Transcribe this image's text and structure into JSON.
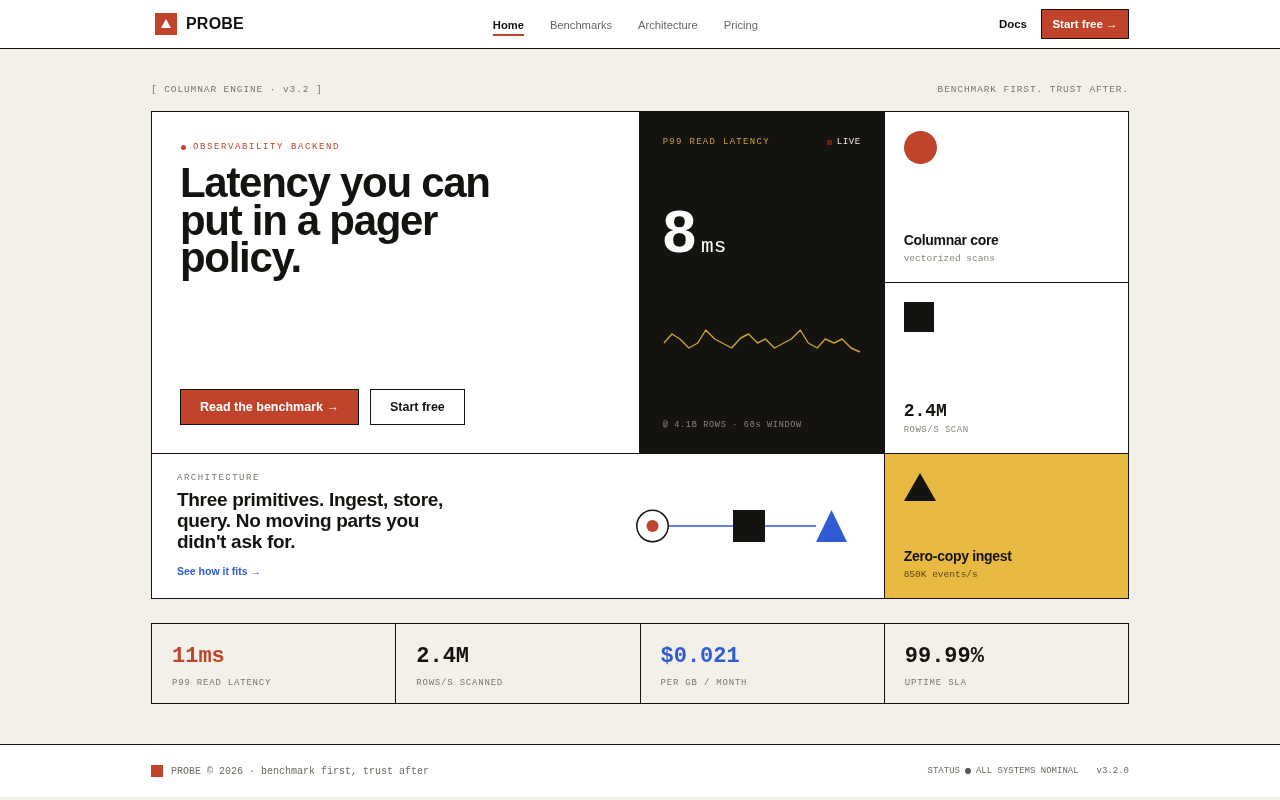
{
  "header": {
    "logo": "PROBE",
    "nav": [
      {
        "label": "Home",
        "selected": true
      },
      {
        "label": "Benchmarks",
        "selected": false
      },
      {
        "label": "Architecture",
        "selected": false
      },
      {
        "label": "Pricing",
        "selected": false
      }
    ],
    "docs_link": "Docs",
    "cta": "Start free →"
  },
  "intro": {
    "tag": "[ COLUMNAR ENGINE · v3.2 ]",
    "motto": "BENCHMARK FIRST. TRUST AFTER."
  },
  "hero": {
    "eyebrow": "OBSERVABILITY BACKEND",
    "title": "Latency you can put in a pager policy.",
    "buttons": [
      {
        "label": "Read the benchmark →",
        "kind": "primary"
      },
      {
        "label": "Start free",
        "kind": "secondary"
      }
    ]
  },
  "latency_card": {
    "label": "P99 READ LATENCY",
    "live": "LIVE",
    "value": "8",
    "unit": "ms",
    "footnote": "@ 4.1B ROWS · 60s WINDOW"
  },
  "core_card": {
    "title": "Columnar core",
    "caption": "vectorized scans"
  },
  "scan_card": {
    "value": "2.4M",
    "caption": "ROWS/S SCAN"
  },
  "architecture": {
    "label": "ARCHITECTURE",
    "title": "Three primitives. Ingest, store, query. No moving parts you didn't ask for.",
    "link": "See how it fits →"
  },
  "ingest_card": {
    "title": "Zero-copy ingest",
    "caption": "850K events/s"
  },
  "stats": [
    {
      "value": "11ms",
      "label": "P99 READ LATENCY",
      "color": "#c0432b"
    },
    {
      "value": "2.4M",
      "label": "ROWS/S SCANNED",
      "color": "#15130f"
    },
    {
      "value": "$0.021",
      "label": "PER GB / MONTH",
      "color": "#2f5cd4"
    },
    {
      "value": "99.99%",
      "label": "UPTIME SLA",
      "color": "#15130f"
    }
  ],
  "footer": {
    "brand": "PROBE © 2026 · benchmark first, trust after",
    "status_label": "STATUS",
    "status": "ALL SYSTEMS NOMINAL",
    "version": "v3.2.0"
  }
}
